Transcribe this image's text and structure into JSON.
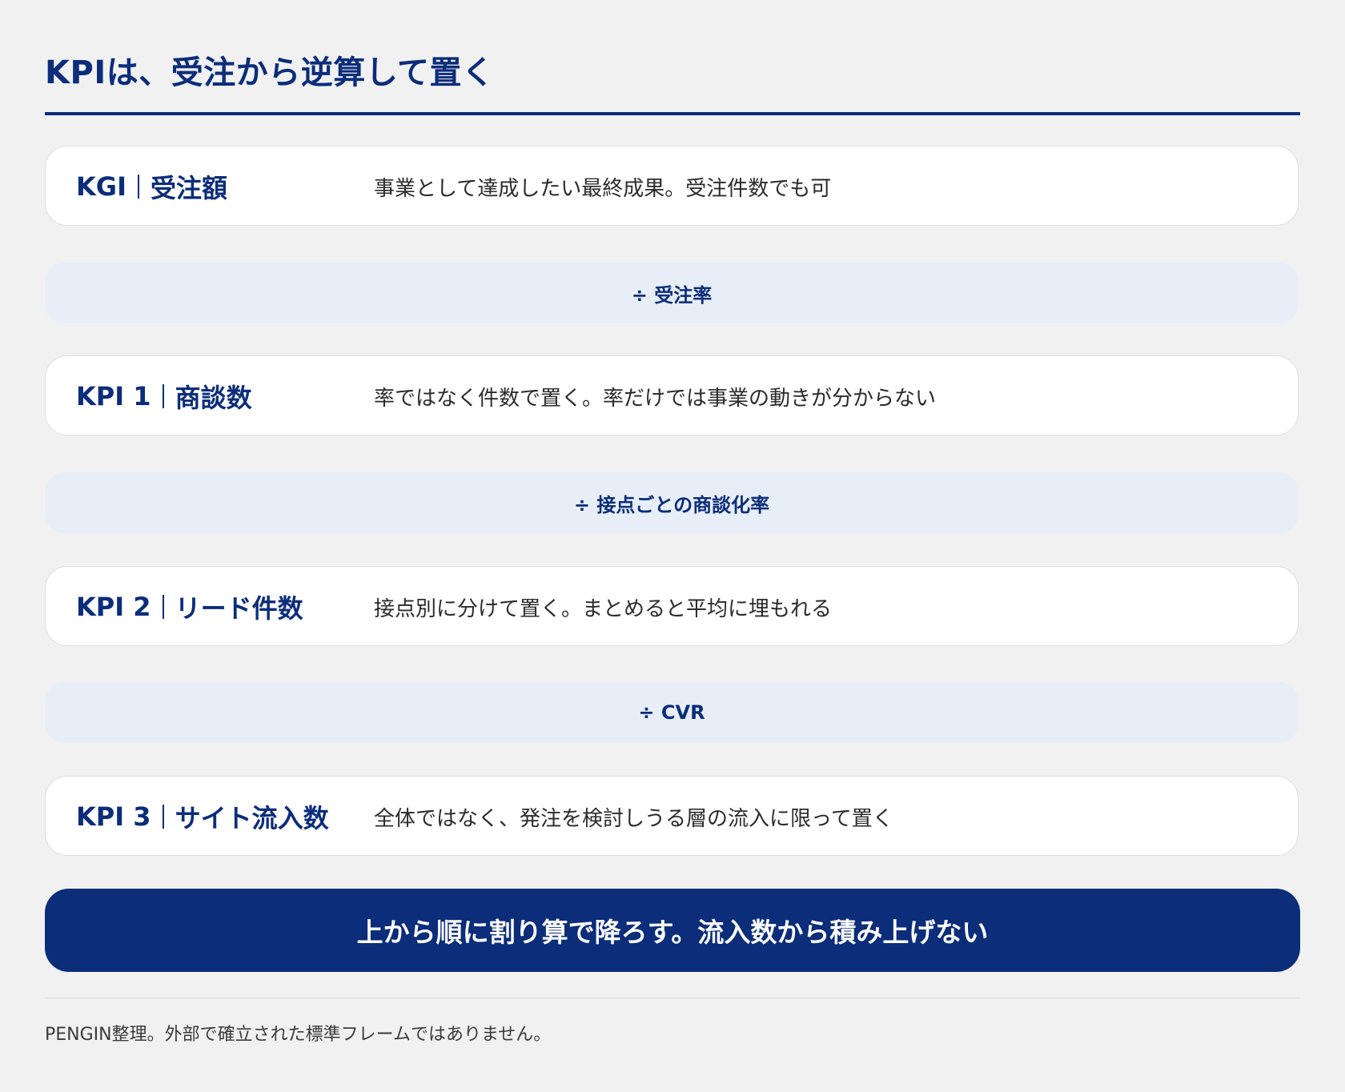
{
  "title": "KPIは、受注から逆算して置く",
  "colors": {
    "accent": "#0b2d7a",
    "background": "#f1f1f2",
    "card": "#ffffff",
    "connector": "#e8eef7"
  },
  "rows": [
    {
      "tag": "KGI",
      "name": "受注額",
      "desc": "事業として達成したい最終成果。受注件数でも可"
    },
    {
      "operator": "÷ 受注率"
    },
    {
      "tag": "KPI 1",
      "name": "商談数",
      "desc": "率ではなく件数で置く。率だけでは事業の動きが分からない"
    },
    {
      "operator": "÷ 接点ごとの商談化率"
    },
    {
      "tag": "KPI 2",
      "name": "リード件数",
      "desc": "接点別に分けて置く。まとめると平均に埋もれる"
    },
    {
      "operator": "÷ CVR"
    },
    {
      "tag": "KPI 3",
      "name": "サイト流入数",
      "desc": "全体ではなく、発注を検討しうる層の流入に限って置く"
    }
  ],
  "banner": "上から順に割り算で降ろす。流入数から積み上げない",
  "footnote": "PENGIN整理。外部で確立された標準フレームではありません。"
}
